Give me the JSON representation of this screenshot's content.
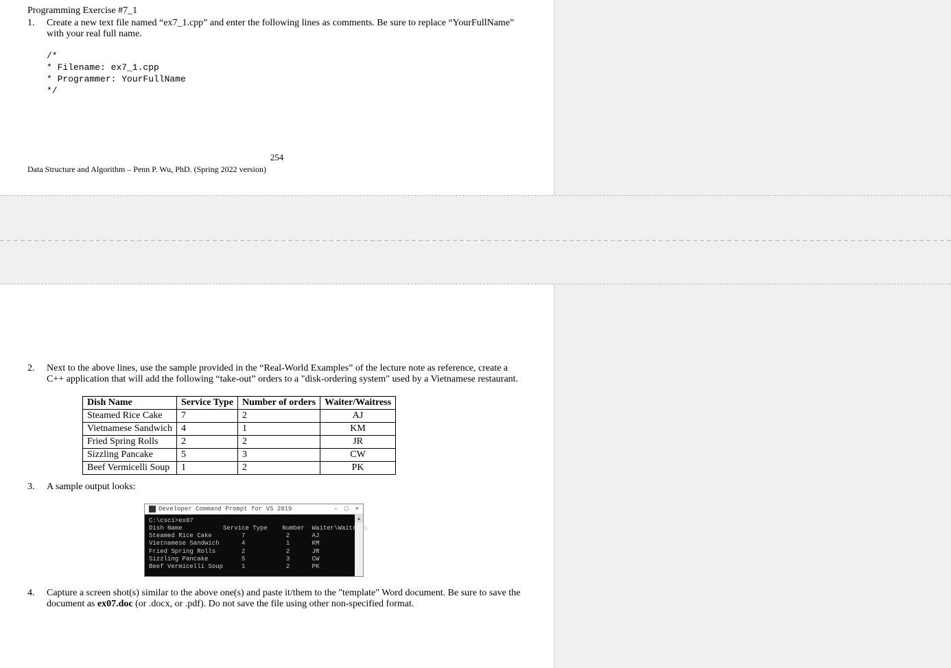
{
  "page_top": {
    "title": "Programming Exercise #7_1",
    "item1_num": "1.",
    "item1_text": "Create a new text file named “ex7_1.cpp” and enter the following lines as comments. Be sure to replace “YourFullName” with your real full name.",
    "code_lines": "/*\n* Filename: ex7_1.cpp\n* Programmer: YourFullName\n*/",
    "page_number": "254",
    "footer": "Data Structure and Algorithm – Penn P. Wu, PhD. (Spring 2022 version)"
  },
  "page_bottom": {
    "item2_num": "2.",
    "item2_text": "Next to the above lines, use the sample provided in the “Real-World Examples” of the lecture note as reference, create a C++ application that will add the following “take-out” orders to a \"disk-ordering system\" used by a Vietnamese restaurant.",
    "table": {
      "headers": [
        "Dish Name",
        "Service Type",
        "Number of orders",
        "Waiter/Waitress"
      ],
      "rows": [
        {
          "dish": "Steamed Rice Cake",
          "service": "7",
          "number": "2",
          "waiter": "AJ"
        },
        {
          "dish": "Vietnamese Sandwich",
          "service": "4",
          "number": "1",
          "waiter": "KM"
        },
        {
          "dish": "Fried Spring Rolls",
          "service": "2",
          "number": "2",
          "waiter": "JR"
        },
        {
          "dish": "Sizzling Pancake",
          "service": "5",
          "number": "3",
          "waiter": "CW"
        },
        {
          "dish": "Beef Vermicelli Soup",
          "service": "1",
          "number": "2",
          "waiter": "PK"
        }
      ]
    },
    "item3_num": "3.",
    "item3_text": "A sample output looks:",
    "console": {
      "title": "Developer Command Prompt for VS 2019",
      "minimize": "–",
      "maximize": "□",
      "close": "×",
      "body": "C:\\csci>ex07\nDish Name           Service Type    Number  Waiter\\Waitress\nSteamed Rice Cake        7           2      AJ\nVietnamese Sandwich      4           1      KM\nFried Spring Rolls       2           2      JR\nSizzling Pancake         5           3      CW\nBeef Vermicelli Soup     1           2      PK"
    },
    "item4_num": "4.",
    "item4_text": "Capture a screen shot(s) similar to the above one(s) and paste it/them to the “template” Word document. Be sure to save the document as ex07.doc (or .docx, or .pdf). Do not save the file using other non-specified format."
  }
}
